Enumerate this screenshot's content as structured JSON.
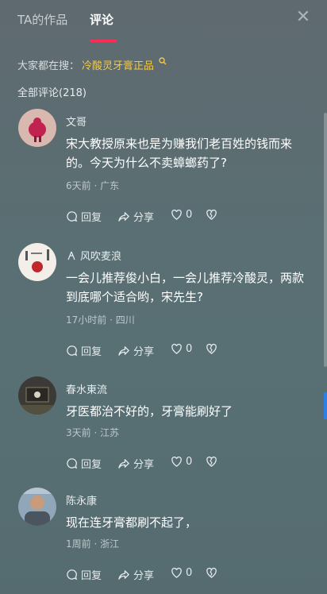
{
  "header": {
    "tab_works": "TA的作品",
    "tab_comments": "评论",
    "close_glyph": "✕"
  },
  "search": {
    "prefix": "大家都在搜：",
    "link": "冷酸灵牙膏正品"
  },
  "comment_count": "全部评论(218)",
  "comments": [
    {
      "name": "文哥",
      "text": "宋大教授原来也是为赚我们老百姓的钱而来的。今天为什么不卖蟑螂药了?",
      "meta": "6天前 · 广东",
      "reply": "回复",
      "share": "分享",
      "likes": "0"
    },
    {
      "name": "风吹麦浪",
      "text": "一会儿推荐俊小白，一会儿推荐冷酸灵，两款到底哪个适合哟，宋先生?",
      "meta": "17小时前 · 四川",
      "reply": "回复",
      "share": "分享",
      "likes": "0"
    },
    {
      "name": "春水東流",
      "text": "牙医都治不好的，牙膏能刷好了",
      "meta": "3天前 · 江苏",
      "reply": "回复",
      "share": "分享",
      "likes": "0"
    },
    {
      "name": "陈永康",
      "text": "现在连牙膏都刷不起了，",
      "meta": "1周前 · 浙江",
      "reply": "回复",
      "share": "分享",
      "likes": "0"
    }
  ],
  "colors": {
    "accent": "#ff2c55",
    "search_link": "#f2c94c"
  }
}
